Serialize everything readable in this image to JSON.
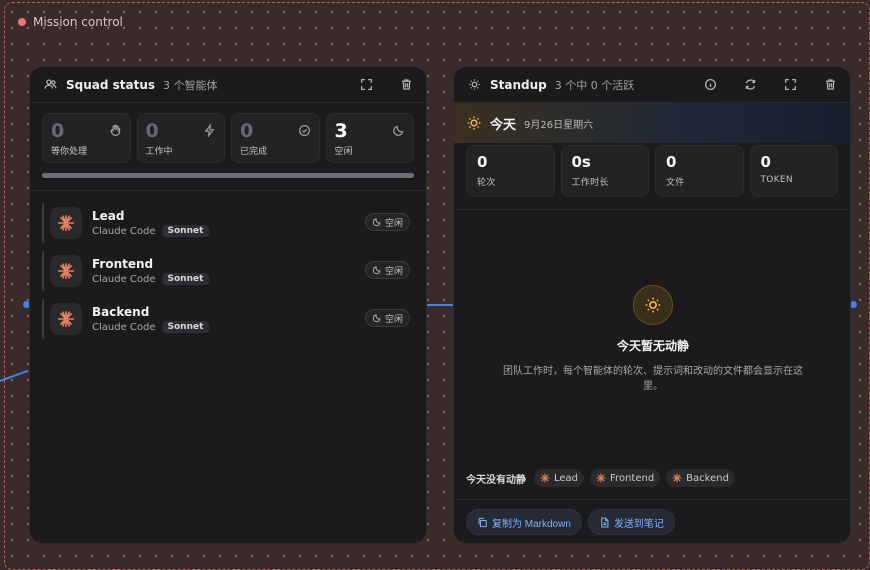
{
  "canvas": {
    "title": "Mission control",
    "accent": "#3b82f6",
    "frame_color": "#c06060"
  },
  "squad": {
    "title": "Squad status",
    "subtitle": "3 个智能体",
    "icons": [
      "users-icon",
      "expand-icon",
      "trash-icon"
    ],
    "stats": [
      {
        "value": "0",
        "label": "等你处理",
        "icon": "hand-icon",
        "active": false
      },
      {
        "value": "0",
        "label": "工作中",
        "icon": "bolt-icon",
        "active": false
      },
      {
        "value": "0",
        "label": "已完成",
        "icon": "check-circle-icon",
        "active": false
      },
      {
        "value": "3",
        "label": "空闲",
        "icon": "moon-icon",
        "active": true
      }
    ],
    "progress": 1.0,
    "agents": [
      {
        "name": "Lead",
        "runtime": "Claude Code",
        "model": "Sonnet",
        "status": "空闲"
      },
      {
        "name": "Frontend",
        "runtime": "Claude Code",
        "model": "Sonnet",
        "status": "空闲"
      },
      {
        "name": "Backend",
        "runtime": "Claude Code",
        "model": "Sonnet",
        "status": "空闲"
      }
    ]
  },
  "standup": {
    "title": "Standup",
    "subtitle": "3 个中 0 个活跃",
    "icons": [
      "sun-icon",
      "info-icon",
      "refresh-icon",
      "expand-icon",
      "trash-icon"
    ],
    "today": {
      "label": "今天",
      "date": "9月26日星期六"
    },
    "metrics": [
      {
        "value": "0",
        "label": "轮次"
      },
      {
        "value": "0s",
        "label": "工作时长"
      },
      {
        "value": "0",
        "label": "文件"
      },
      {
        "value": "0",
        "label": "TOKEN"
      }
    ],
    "empty": {
      "title": "今天暂无动静",
      "description": "团队工作时，每个智能体的轮次、提示词和改动的文件都会显示在这里。"
    },
    "quiet": {
      "label": "今天没有动静",
      "agents": [
        "Lead",
        "Frontend",
        "Backend"
      ]
    },
    "actions": {
      "copy_markdown": "复制为 Markdown",
      "send_to_notes": "发送到笔记"
    }
  }
}
